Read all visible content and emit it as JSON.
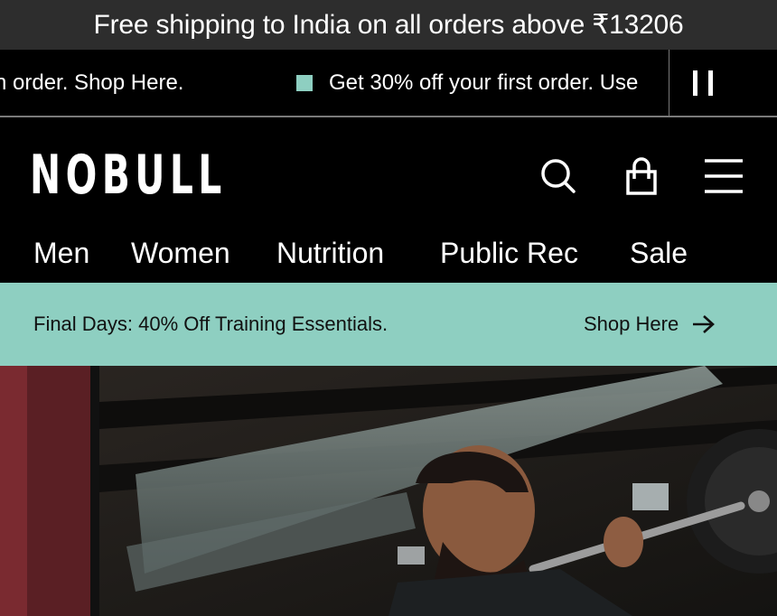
{
  "shipping_bar": {
    "text": "Free shipping to India on all orders above ₹13206"
  },
  "promo_strip": {
    "left_text": "n order. Shop Here.",
    "right_text": "Get 30% off your first order. Use",
    "pause_label": "Pause",
    "marker_color": "#8ecfc1"
  },
  "header": {
    "logo": "NOBULL",
    "icons": {
      "search": "search-icon",
      "cart": "shopping-bag-icon",
      "menu": "hamburger-menu-icon"
    }
  },
  "nav": {
    "items": [
      "Men",
      "Women",
      "Nutrition",
      "Public Rec",
      "Sale"
    ]
  },
  "offer_bar": {
    "text": "Final Days: 40% Off Training Essentials.",
    "link": "Shop Here",
    "background": "#8ecfc1"
  },
  "hero": {
    "image": "man performing barbell squat in gym"
  }
}
